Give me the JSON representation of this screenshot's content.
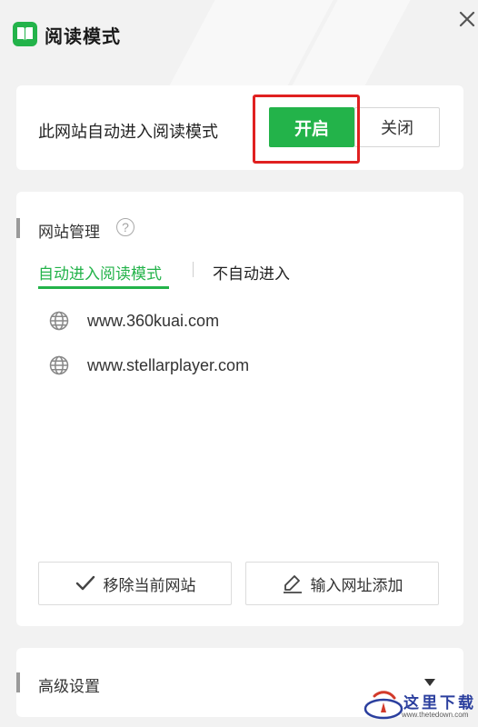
{
  "header": {
    "title": "阅读模式",
    "icon": "book-icon",
    "close_icon": "close-icon"
  },
  "auto_reading": {
    "label": "此网站自动进入阅读模式",
    "on_label": "开启",
    "off_label": "关闭",
    "selected": "开启"
  },
  "site_management": {
    "title": "网站管理",
    "help_icon": "?",
    "tabs": [
      {
        "label": "自动进入阅读模式",
        "active": true
      },
      {
        "label": "不自动进入",
        "active": false
      }
    ],
    "sites": [
      {
        "url": "www.360kuai.com"
      },
      {
        "url": "www.stellarplayer.com"
      }
    ],
    "remove_button": "移除当前网站",
    "add_button": "输入网址添加"
  },
  "advanced": {
    "title": "高级设置"
  },
  "watermark": {
    "brand": "这里下载",
    "url": "www.thetedown.com"
  },
  "colors": {
    "accent": "#23b34a",
    "highlight": "#e02020",
    "background": "#f2f2f2"
  }
}
